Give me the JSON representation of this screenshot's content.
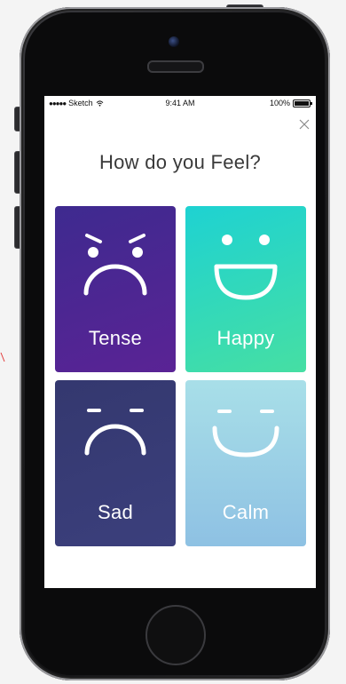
{
  "status_bar": {
    "carrier": "Sketch",
    "time": "9:41 AM",
    "battery": "100%"
  },
  "screen": {
    "title": "How do you Feel?",
    "close_icon": "close-icon"
  },
  "moods": [
    {
      "label": "Tense",
      "icon": "tense-face-icon",
      "colors": [
        "#3e2a8f",
        "#5a2395"
      ]
    },
    {
      "label": "Happy",
      "icon": "happy-face-icon",
      "colors": [
        "#1ed2d2",
        "#46dfa3"
      ]
    },
    {
      "label": "Sad",
      "icon": "sad-face-icon",
      "colors": [
        "#34386f",
        "#3b3f7c"
      ]
    },
    {
      "label": "Calm",
      "icon": "calm-face-icon",
      "colors": [
        "#a8dfe8",
        "#8ec1e3"
      ]
    }
  ]
}
